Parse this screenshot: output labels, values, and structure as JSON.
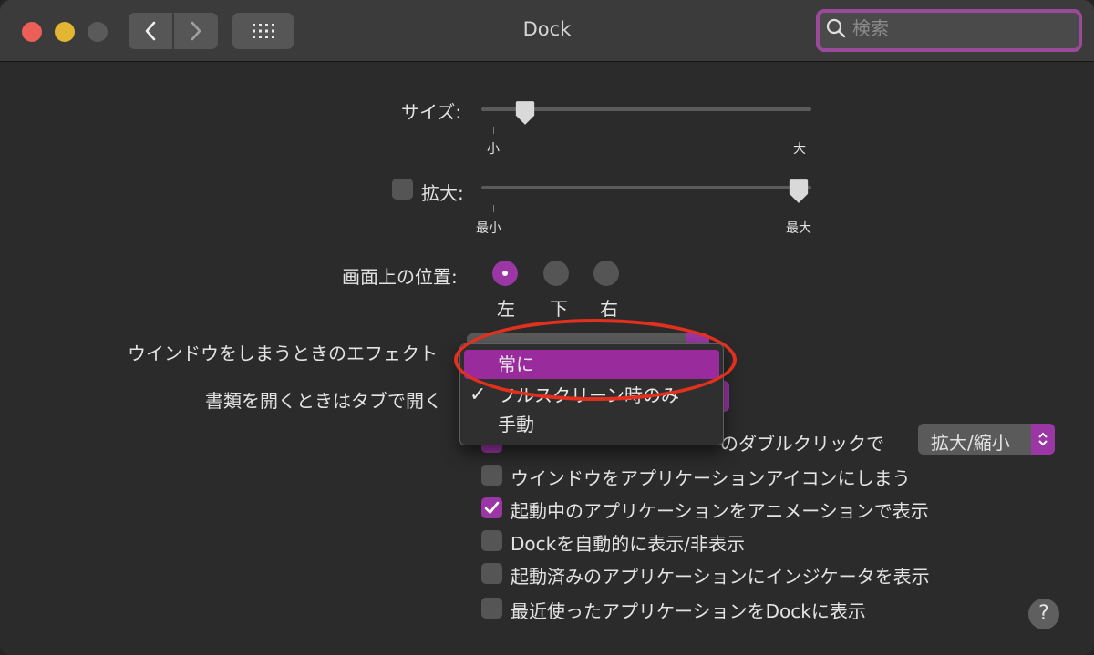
{
  "window": {
    "title": "Dock"
  },
  "search": {
    "placeholder": "検索",
    "value": ""
  },
  "size": {
    "label": "サイズ:",
    "min_label": "小",
    "max_label": "大",
    "value": 0.13
  },
  "magnification": {
    "label": "拡大:",
    "checked": false,
    "min_label": "最小",
    "max_label": "最大",
    "value": 0.97
  },
  "position": {
    "label": "画面上の位置:",
    "options": [
      {
        "label": "左",
        "selected": true
      },
      {
        "label": "下",
        "selected": false
      },
      {
        "label": "右",
        "selected": false
      }
    ]
  },
  "minimize_effect": {
    "label": "ウインドウをしまうときのエフェクト"
  },
  "tabs_open": {
    "label": "書類を開くときはタブで開く"
  },
  "menu": {
    "items": [
      {
        "label": "常に",
        "highlighted": true,
        "checked": false
      },
      {
        "label": "フルスクリーン時のみ",
        "highlighted": false,
        "checked": true
      },
      {
        "label": "手動",
        "highlighted": false,
        "checked": false
      }
    ],
    "checkmark": "✓"
  },
  "double_click": {
    "label": "のダブルクリックで",
    "value": "拡大/縮小"
  },
  "checkboxes": [
    {
      "label": "ウインドウをアプリケーションアイコンにしまう",
      "checked": false
    },
    {
      "label": "起動中のアプリケーションをアニメーションで表示",
      "checked": true
    },
    {
      "label": "Dockを自動的に表示/非表示",
      "checked": false
    },
    {
      "label": "起動済みのアプリケーションにインジケータを表示",
      "checked": false
    },
    {
      "label": "最近使ったアプリケーションをDockに表示",
      "checked": false
    }
  ],
  "help": {
    "label": "?"
  },
  "colors": {
    "accent": "#9a37a4",
    "annotation": "#e2301e",
    "background": "#2b2b2b"
  }
}
